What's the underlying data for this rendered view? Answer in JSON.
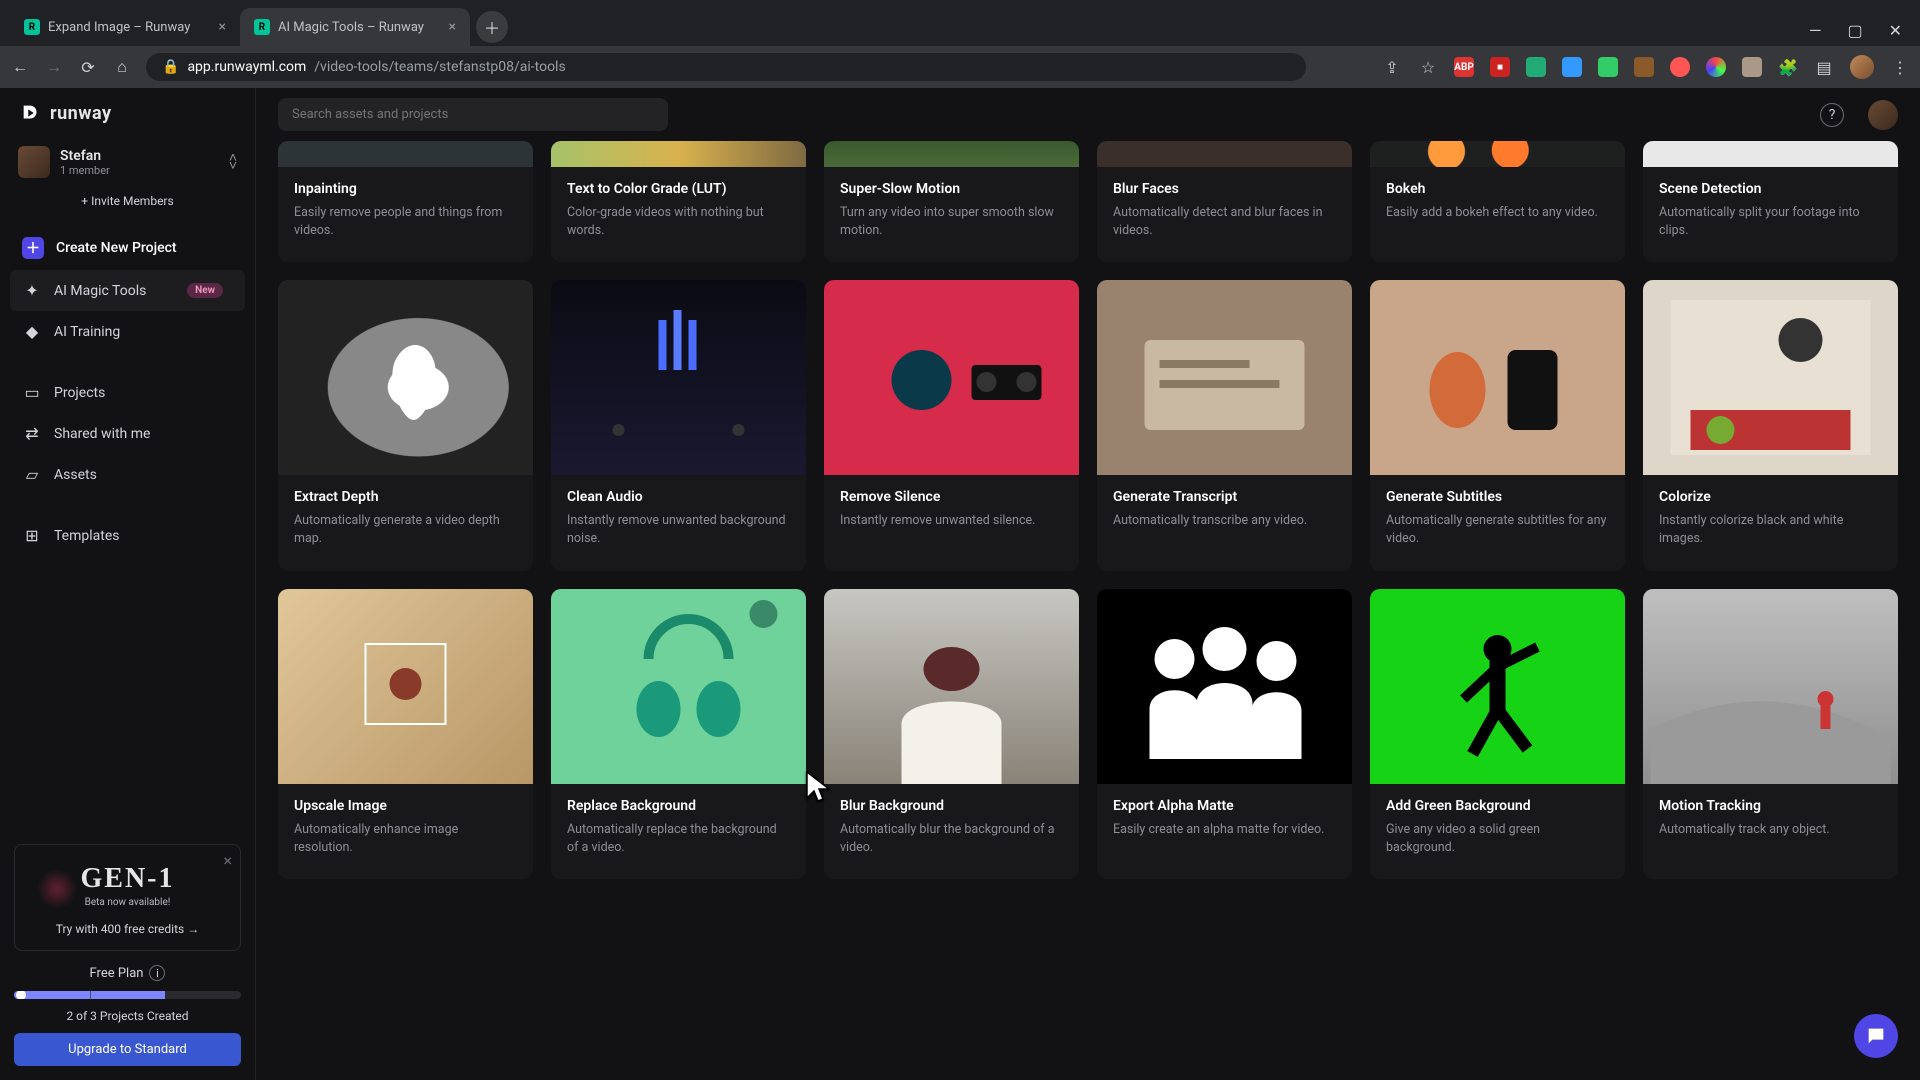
{
  "browser": {
    "tabs": [
      {
        "title": "Expand Image – Runway",
        "active": false
      },
      {
        "title": "AI Magic Tools – Runway",
        "active": true
      }
    ],
    "url_host": "app.runwayml.com",
    "url_path": "/video-tools/teams/stefanstp08/ai-tools"
  },
  "logo_text": "runway",
  "user": {
    "name": "Stefan",
    "members": "1 member"
  },
  "invite_label": "+ Invite Members",
  "nav": {
    "create": "Create New Project",
    "magic": "AI Magic Tools",
    "magic_badge": "New",
    "training": "AI Training",
    "projects": "Projects",
    "shared": "Shared with me",
    "assets": "Assets",
    "templates": "Templates"
  },
  "promo": {
    "title": "GEN-1",
    "subtitle": "Beta now available!",
    "link": "Try with 400 free credits →"
  },
  "plan": {
    "name": "Free Plan",
    "counter": "2 of 3 Projects Created",
    "upgrade": "Upgrade to Standard"
  },
  "search_placeholder": "Search assets and projects",
  "tools_row_cut": [
    {
      "key": "inpaint",
      "title": "Inpainting",
      "desc": "Easily remove people and things from videos."
    },
    {
      "key": "lut",
      "title": "Text to Color Grade (LUT)",
      "desc": "Color-grade videos with nothing but words."
    },
    {
      "key": "slow",
      "title": "Super-Slow Motion",
      "desc": "Turn any video into super smooth slow motion."
    },
    {
      "key": "blurf",
      "title": "Blur Faces",
      "desc": "Automatically detect and blur faces in videos."
    },
    {
      "key": "bokeh",
      "title": "Bokeh",
      "desc": "Easily add a bokeh effect to any video."
    },
    {
      "key": "scene",
      "title": "Scene Detection",
      "desc": "Automatically split your footage into clips."
    }
  ],
  "tools_row_b": [
    {
      "key": "depth",
      "title": "Extract Depth",
      "desc": "Automatically generate a video depth map."
    },
    {
      "key": "audio",
      "title": "Clean Audio",
      "desc": "Instantly remove unwanted background noise."
    },
    {
      "key": "silence",
      "title": "Remove Silence",
      "desc": "Instantly remove unwanted silence."
    },
    {
      "key": "transcript",
      "title": "Generate Transcript",
      "desc": "Automatically transcribe any video."
    },
    {
      "key": "subtitles",
      "title": "Generate Subtitles",
      "desc": "Automatically generate subtitles for any video."
    },
    {
      "key": "colorize",
      "title": "Colorize",
      "desc": "Instantly colorize black and white images."
    }
  ],
  "tools_row_c": [
    {
      "key": "upscale",
      "title": "Upscale Image",
      "desc": "Automatically enhance image resolution."
    },
    {
      "key": "replace",
      "title": "Replace Background",
      "desc": "Automatically replace the background of a video."
    },
    {
      "key": "blurbg",
      "title": "Blur Background",
      "desc": "Automatically blur the background of a video."
    },
    {
      "key": "alpha",
      "title": "Export Alpha Matte",
      "desc": "Easily create an alpha matte for video."
    },
    {
      "key": "green",
      "title": "Add Green Background",
      "desc": "Give any video a solid green background."
    },
    {
      "key": "track",
      "title": "Motion Tracking",
      "desc": "Automatically track any object."
    }
  ]
}
